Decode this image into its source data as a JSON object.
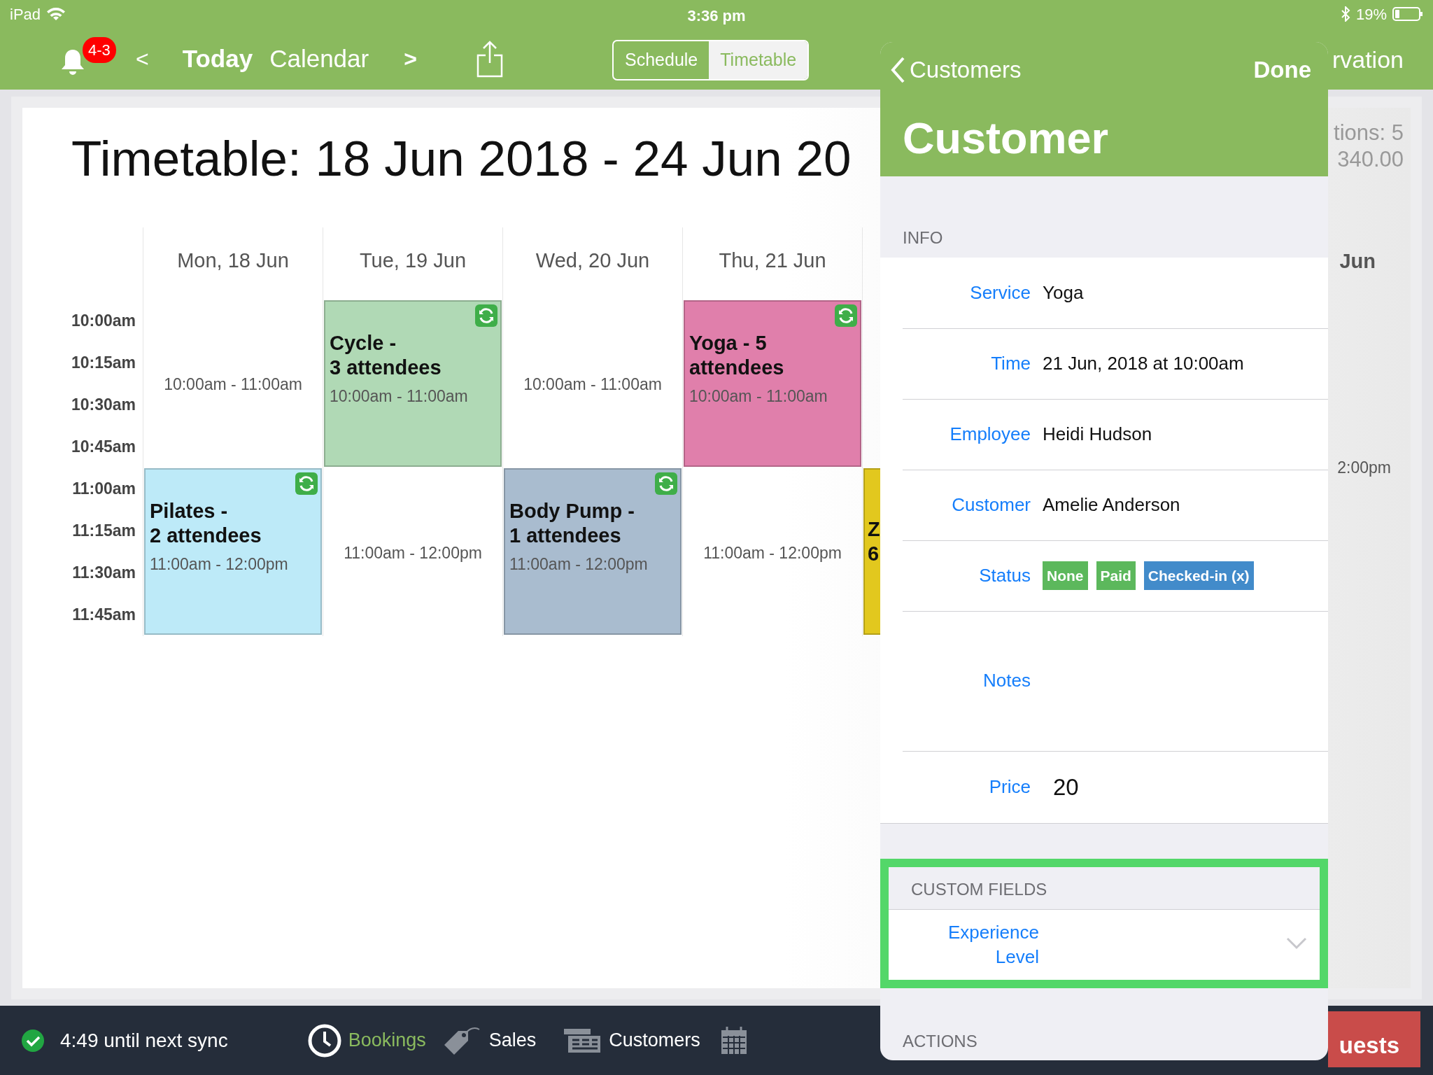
{
  "status_bar": {
    "device": "iPad",
    "time": "3:36 pm",
    "battery": "19%"
  },
  "nav": {
    "badge": "4-3",
    "prev": "<",
    "today": "Today",
    "calendar": "Calendar",
    "next": ">",
    "segments": [
      {
        "label": "Schedule",
        "selected": false
      },
      {
        "label": "Timetable",
        "selected": true
      }
    ],
    "right_text": "rvation"
  },
  "timetable": {
    "title": "Timetable: 18 Jun 2018 - 24 Jun 20",
    "times": [
      "10:00am",
      "10:15am",
      "10:30am",
      "10:45am",
      "11:00am",
      "11:15am",
      "11:30am",
      "11:45am"
    ],
    "days": [
      {
        "label": "Mon, 18 Jun",
        "slots": [
          {
            "kind": "free",
            "time": "10:00am - 11:00am"
          },
          {
            "kind": "event",
            "title": "Pilates -\n2 attendees",
            "time": "11:00am - 12:00pm",
            "color": "#bdeaf8",
            "recurring": true
          }
        ]
      },
      {
        "label": "Tue, 19 Jun",
        "slots": [
          {
            "kind": "event",
            "title": "Cycle -\n3 attendees",
            "time": "10:00am - 11:00am",
            "color": "#b0d9b5",
            "recurring": true
          },
          {
            "kind": "free",
            "time": "11:00am - 12:00pm"
          }
        ]
      },
      {
        "label": "Wed, 20 Jun",
        "slots": [
          {
            "kind": "free",
            "time": "10:00am - 11:00am"
          },
          {
            "kind": "event",
            "title": "Body Pump -\n1 attendees",
            "time": "11:00am - 12:00pm",
            "color": "#a9bccf",
            "recurring": true
          }
        ]
      },
      {
        "label": "Thu, 21 Jun",
        "slots": [
          {
            "kind": "event",
            "title": "Yoga - 5\nattendees",
            "time": "10:00am - 11:00am",
            "color": "#e07fab",
            "recurring": true
          },
          {
            "kind": "free",
            "time": "11:00am - 12:00pm"
          }
        ]
      },
      {
        "slots": [
          {
            "kind": "empty"
          },
          {
            "kind": "event",
            "title": "Z\n6",
            "color": "#e2c81e",
            "recurring": false
          }
        ]
      }
    ]
  },
  "right_edge": {
    "stats": [
      "tions: 5",
      "340.00"
    ],
    "day_label": "Jun",
    "slot_text": "2:00pm"
  },
  "popover": {
    "back": "Customers",
    "done": "Done",
    "title": "Customer",
    "sections": [
      {
        "header": "INFO",
        "highlighted": false,
        "rows": [
          {
            "kind": "text",
            "label": "Service",
            "value": "Yoga"
          },
          {
            "kind": "text",
            "label": "Time",
            "value": "21 Jun, 2018 at 10:00am"
          },
          {
            "kind": "text",
            "label": "Employee",
            "value": "Heidi Hudson"
          },
          {
            "kind": "text",
            "label": "Customer",
            "value": "Amelie Anderson"
          },
          {
            "kind": "badges",
            "label": "Status",
            "badges": [
              {
                "text": "None",
                "color": "#5cb85c"
              },
              {
                "text": "Paid",
                "color": "#5cb85c"
              },
              {
                "text": "Checked-in (x)",
                "color": "#428bca"
              }
            ]
          },
          {
            "kind": "notes",
            "label": "Notes"
          },
          {
            "kind": "input",
            "label": "Price",
            "value": "20"
          }
        ]
      },
      {
        "header": "CUSTOM FIELDS",
        "highlighted": true,
        "rows": [
          {
            "kind": "picker",
            "label": "Experience\nLevel"
          }
        ]
      },
      {
        "header": "ACTIONS",
        "highlighted": false
      }
    ]
  },
  "bottom_bar": {
    "sync": "4:49 until next sync",
    "tabs": [
      {
        "kind": "clock",
        "label": "Bookings",
        "selected": true
      },
      {
        "kind": "tag",
        "label": "Sales",
        "selected": false
      },
      {
        "kind": "register",
        "label": "Customers",
        "selected": false
      },
      {
        "kind": "calendar",
        "selected": false
      }
    ],
    "red_button": "uests"
  }
}
